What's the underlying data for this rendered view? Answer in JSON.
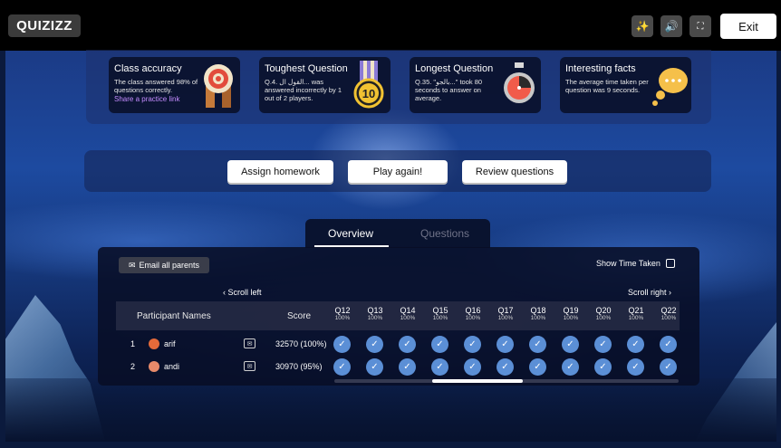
{
  "header": {
    "logo": "QUIZIZZ",
    "exit_label": "Exit",
    "icons": [
      "magic-wand-icon",
      "volume-icon",
      "fullscreen-icon"
    ]
  },
  "cards": [
    {
      "title": "Class accuracy",
      "text": "The class answered 98% of questions correctly.",
      "link": "Share a practice link",
      "icon": "target-medal-icon"
    },
    {
      "title": "Toughest Question",
      "text": "Q.4. القول ال... was answered incorrectly by 1 out of 2 players.",
      "link": "",
      "icon": "ten-medal-icon"
    },
    {
      "title": "Longest Question",
      "text": "Q.35. \"بالجو...\" took 80 seconds to answer on average.",
      "link": "",
      "icon": "stopwatch-icon"
    },
    {
      "title": "Interesting facts",
      "text": "The average time taken per question was 9 seconds.",
      "link": "",
      "icon": "speech-bubble-icon"
    }
  ],
  "actions": {
    "assign": "Assign homework",
    "play": "Play again!",
    "review": "Review questions"
  },
  "tabs": {
    "overview": "Overview",
    "questions": "Questions"
  },
  "report": {
    "email_all": "Email all parents",
    "show_time": "Show Time Taken",
    "scroll_left": "Scroll left",
    "scroll_right": "Scroll right",
    "col_names": "Participant Names",
    "col_score": "Score",
    "questions": [
      {
        "label": "Q12",
        "pct": "100%"
      },
      {
        "label": "Q13",
        "pct": "100%"
      },
      {
        "label": "Q14",
        "pct": "100%"
      },
      {
        "label": "Q15",
        "pct": "100%"
      },
      {
        "label": "Q16",
        "pct": "100%"
      },
      {
        "label": "Q17",
        "pct": "100%"
      },
      {
        "label": "Q18",
        "pct": "100%"
      },
      {
        "label": "Q19",
        "pct": "100%"
      },
      {
        "label": "Q20",
        "pct": "100%"
      },
      {
        "label": "Q21",
        "pct": "100%"
      },
      {
        "label": "Q22",
        "pct": "100%"
      }
    ],
    "rows": [
      {
        "rank": "1",
        "name": "arif",
        "score": "32570 (100%)"
      },
      {
        "rank": "2",
        "name": "andi",
        "score": "30970 (95%)"
      }
    ]
  }
}
